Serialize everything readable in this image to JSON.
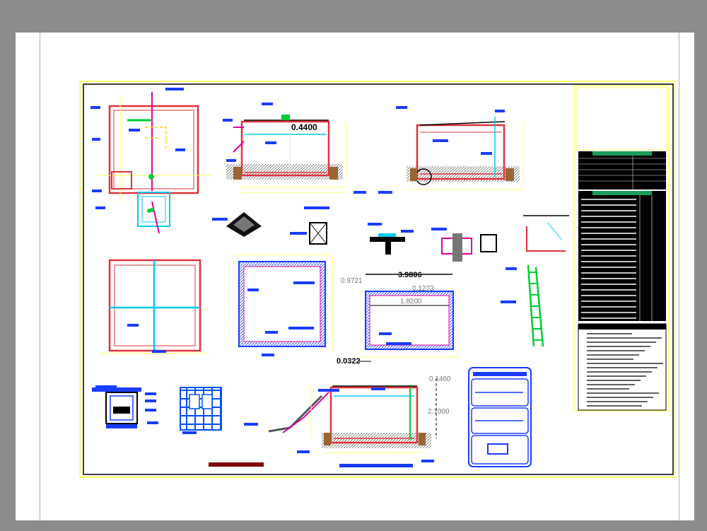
{
  "dimensions": {
    "top_section_height": "0.4400",
    "overall_width": "3.9806",
    "left_offset": "0.9721",
    "lid_offset": "0.1273",
    "inner_width": "1.8200",
    "wall_thickness": "0.0322",
    "top_slab": "0.1460",
    "height_total": "2.1000"
  },
  "colors": {
    "page_bg": "#8c8c8c",
    "sheet_bg": "#ffffff",
    "border_yellow": "#ffff66",
    "wall_red": "#e0323c",
    "pipe_magenta": "#e000a0",
    "label_blue": "#0040ff",
    "green": "#00cc33",
    "cyan": "#00ccee",
    "ground": "#996633"
  }
}
